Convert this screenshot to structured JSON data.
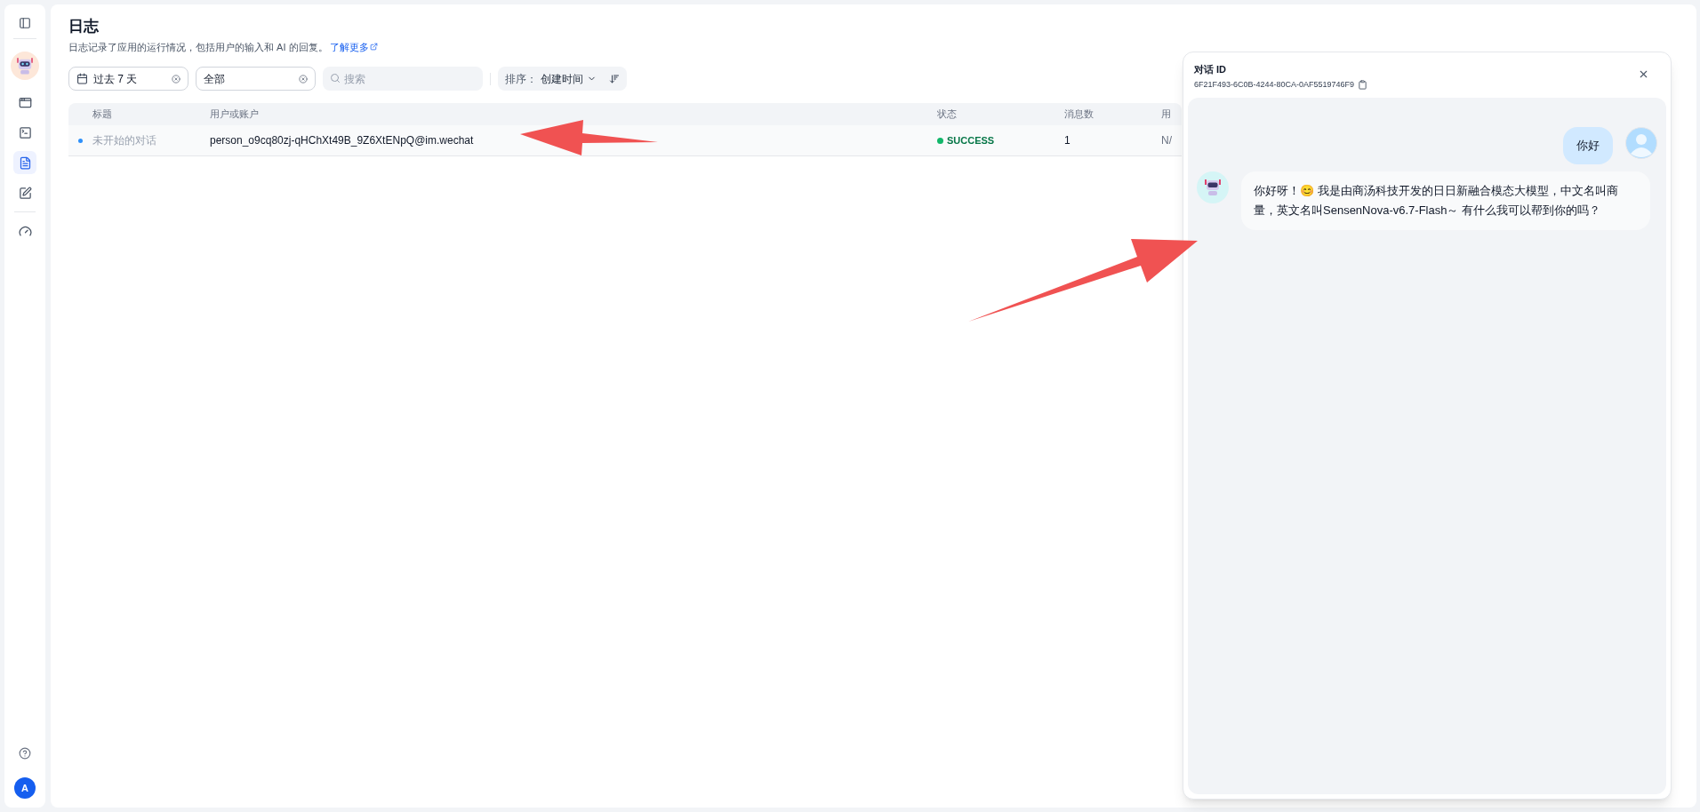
{
  "sidebar": {
    "items": [
      {
        "kind": "apps",
        "selected": false
      },
      {
        "kind": "terminal",
        "selected": false
      },
      {
        "kind": "logs",
        "selected": true
      },
      {
        "kind": "annotate",
        "selected": false
      },
      {
        "kind": "monitor",
        "selected": false
      }
    ],
    "user_initial": "A"
  },
  "page": {
    "title": "日志",
    "description": "日志记录了应用的运行情况，包括用户的输入和 AI 的回复。",
    "link": "了解更多"
  },
  "filters": {
    "period": "过去 7 天",
    "status": "全部",
    "search_placeholder": "搜索",
    "sort_label": "排序：",
    "sort_value": "创建时间"
  },
  "table": {
    "columns": [
      "标题",
      "用户或账户",
      "状态",
      "消息数",
      "用"
    ],
    "rows": [
      {
        "unread": true,
        "title": "未开始的对话",
        "account": "person_o9cq80zj-qHChXt49B_9Z6XtENpQ@im.wechat",
        "status": {
          "label": "SUCCESS",
          "color": "#12b76a"
        },
        "messages": "1",
        "user": "N/"
      }
    ]
  },
  "conversation": {
    "label": "对话 ID",
    "id": "6F21F493-6C0B-4244-80CA-0AF5519746F9",
    "messages": [
      {
        "kind": "user",
        "text": "你好"
      },
      {
        "kind": "assistant",
        "text": "你好呀！😊 我是由商汤科技开发的日日新融合模态大模型，中文名叫商量，英文名叫SensenNova-v6.7-Flash～ 有什么我可以帮到你的吗？"
      }
    ]
  }
}
